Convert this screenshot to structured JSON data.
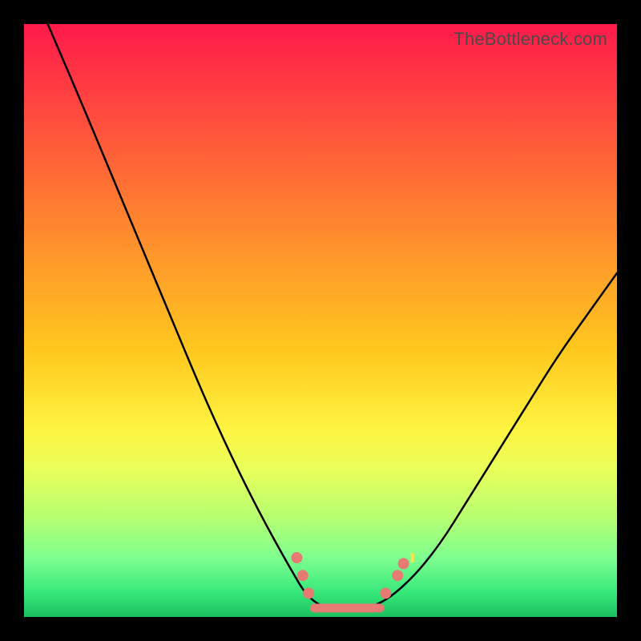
{
  "watermark": "TheBottleneck.com",
  "chart_data": {
    "type": "line",
    "title": "",
    "xlabel": "",
    "ylabel": "",
    "xlim": [
      0,
      100
    ],
    "ylim": [
      0,
      100
    ],
    "series": [
      {
        "name": "bottleneck-curve",
        "x": [
          4,
          10,
          15,
          20,
          25,
          30,
          35,
          40,
          45,
          48,
          52,
          55,
          60,
          65,
          70,
          75,
          80,
          85,
          90,
          95,
          100
        ],
        "y": [
          100,
          86,
          74,
          62,
          50,
          38,
          27,
          17,
          8,
          3,
          1,
          1,
          2,
          6,
          12,
          20,
          28,
          36,
          44,
          51,
          58
        ]
      }
    ],
    "markers": [
      {
        "name": "left-dot-1",
        "x": 46,
        "y": 10
      },
      {
        "name": "left-dot-2",
        "x": 47,
        "y": 7
      },
      {
        "name": "left-dot-3",
        "x": 48,
        "y": 4
      },
      {
        "name": "right-dot-1",
        "x": 61,
        "y": 4
      },
      {
        "name": "right-dot-2",
        "x": 63,
        "y": 7
      },
      {
        "name": "right-dot-3",
        "x": 64,
        "y": 9
      }
    ],
    "flat_segment": {
      "x_start": 49,
      "x_end": 60,
      "y": 1.5
    },
    "annotations": [
      {
        "name": "tiny-yellow-mark",
        "x": 65.5,
        "y": 10
      }
    ]
  }
}
